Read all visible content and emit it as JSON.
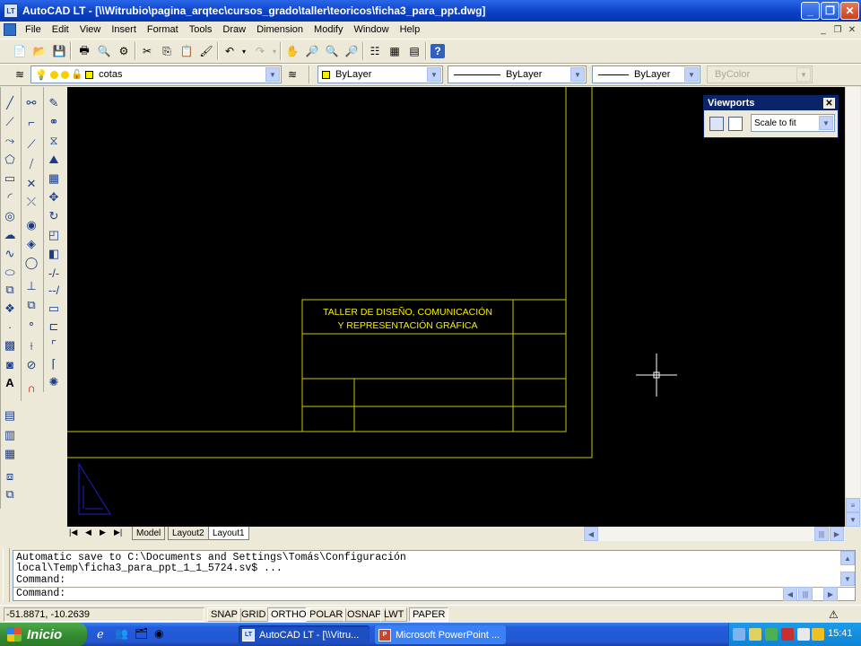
{
  "window": {
    "app_icon_text": "LT",
    "title": "AutoCAD LT - [\\\\Witrubio\\pagina_arqtec\\cursos_grado\\taller\\teoricos\\ficha3_para_ppt.dwg]"
  },
  "menu": {
    "items": [
      "File",
      "Edit",
      "View",
      "Insert",
      "Format",
      "Tools",
      "Draw",
      "Dimension",
      "Modify",
      "Window",
      "Help"
    ]
  },
  "layers_toolbar": {
    "layer_name": "cotas",
    "color": "ByLayer",
    "linetype": "ByLayer",
    "lineweight": "ByLayer",
    "plotstyle": "ByColor"
  },
  "viewports": {
    "title": "Viewports",
    "scale": "Scale to fit"
  },
  "title_block": {
    "line1": "TALLER DE DISEÑO, COMUNICACIÓN",
    "line2": "Y REPRESENTACIÓN GRÁFICA"
  },
  "tabs": {
    "items": [
      "Model",
      "Layout2",
      "Layout1"
    ]
  },
  "command": {
    "line1": "Automatic save to C:\\Documents and Settings\\Tomás\\Configuración",
    "line2": "local\\Temp\\ficha3_para_ppt_1_1_5724.sv$ ...",
    "line3": "Command:",
    "line4": "Command:"
  },
  "status": {
    "coordinates": "-51.8871, -10.2639",
    "buttons": [
      "SNAP",
      "GRID",
      "ORTHO",
      "POLAR",
      "OSNAP",
      "LWT",
      "PAPER"
    ]
  },
  "taskbar": {
    "start_label": "Inicio",
    "task1": "AutoCAD LT - [\\\\Vitru...",
    "task2": "Microsoft PowerPoint ...",
    "clock": "15:41"
  },
  "colors": {
    "drawing_line": "#c8c800",
    "ucs_icon": "#2020c8",
    "canvas_bg": "#000000"
  }
}
